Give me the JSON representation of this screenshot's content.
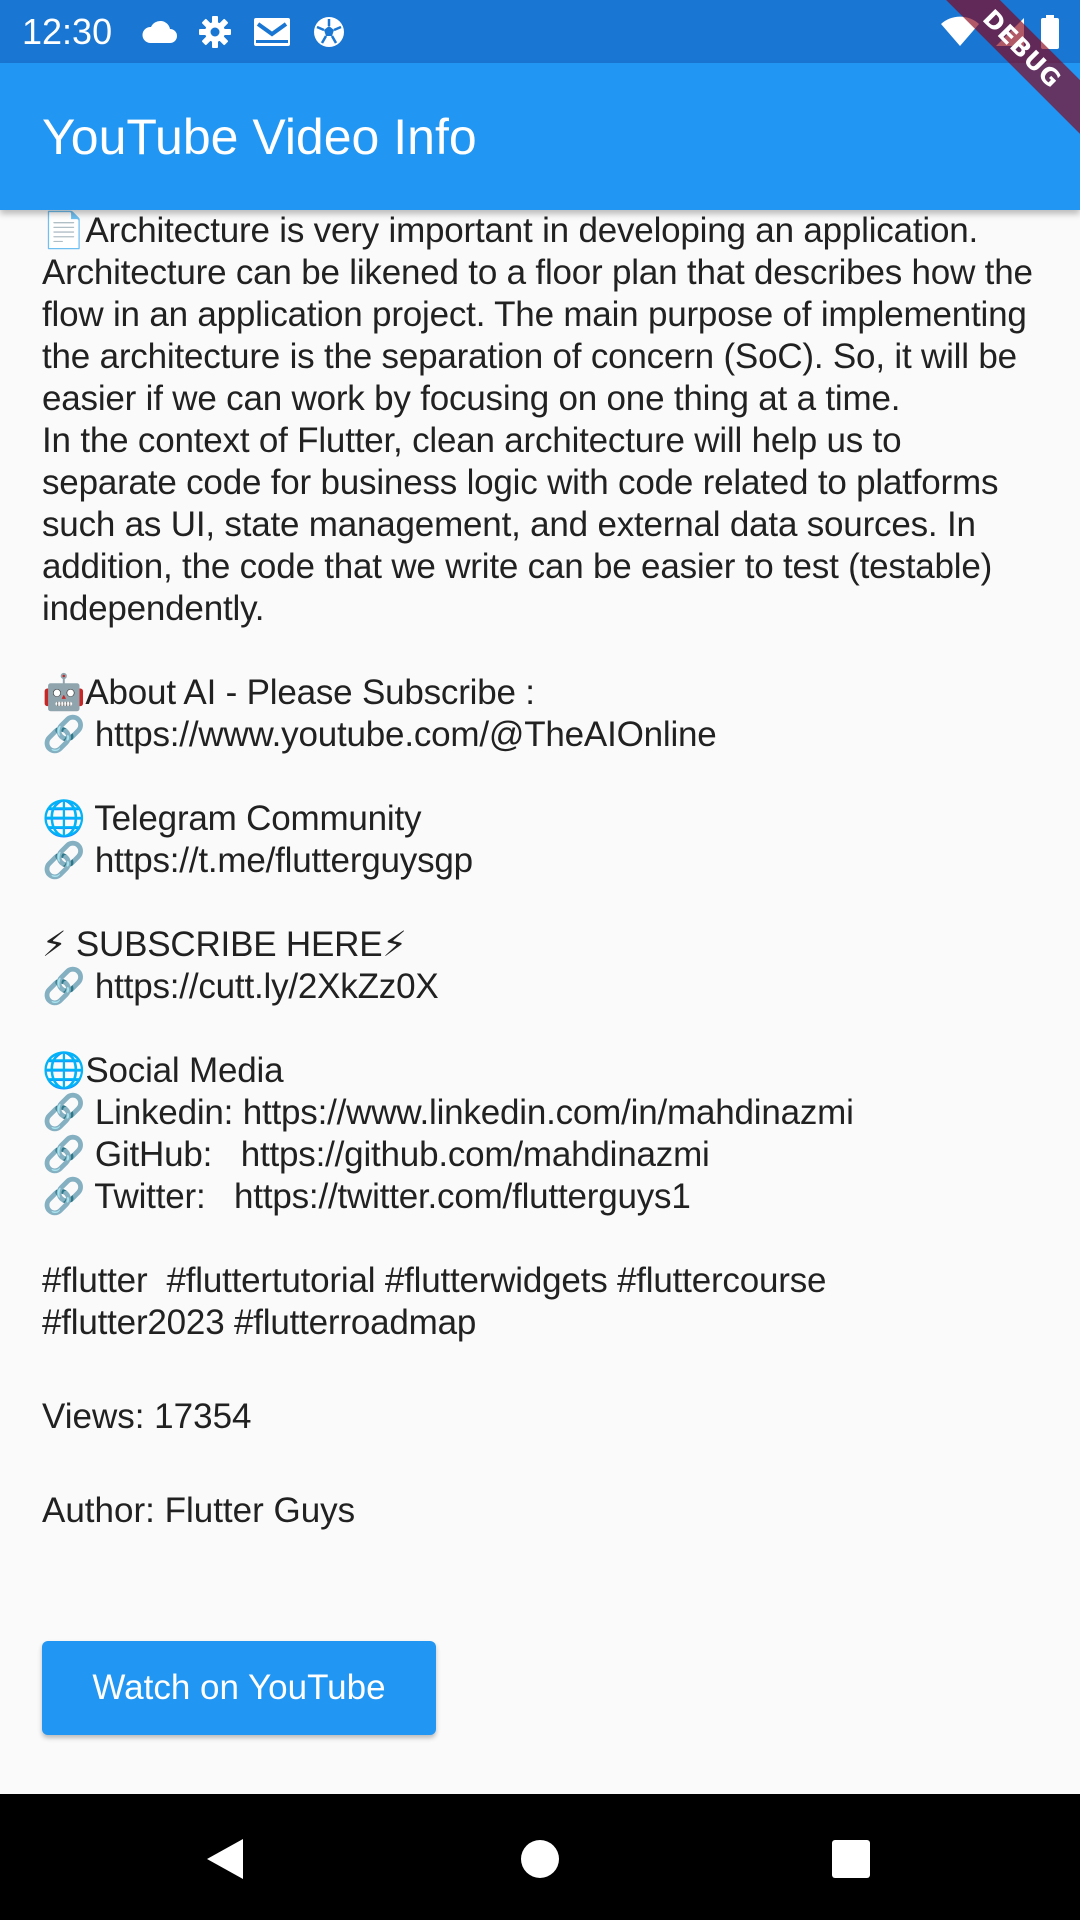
{
  "status_bar": {
    "time": "12:30",
    "left_icons": [
      "cloud-icon",
      "gear-icon",
      "mail-icon",
      "soccer-ball-icon"
    ],
    "right_icons": [
      "wifi-icon",
      "signal-icon",
      "battery-icon"
    ]
  },
  "debug_banner": "DEBUG",
  "app_bar": {
    "title": "YouTube Video Info"
  },
  "video": {
    "description": "📄Architecture is very important in developing an application. Architecture can be likened to a floor plan that describes how the flow in an application project. The main purpose of implementing the architecture is the separation of concern (SoC). So, it will be easier if we can work by focusing on one thing at a time.\nIn the context of Flutter, clean architecture will help us to separate code for business logic with code related to platforms such as UI, state management, and external data sources. In addition, the code that we write can be easier to test (testable) independently.\n\n🤖About AI - Please Subscribe :\n🔗 https://www.youtube.com/@TheAIOnline\n\n🌐 Telegram Community\n🔗 https://t.me/flutterguysgp\n\n⚡ SUBSCRIBE HERE⚡\n🔗 https://cutt.ly/2XkZz0X\n\n🌐Social Media\n🔗 Linkedin: https://www.linkedin.com/in/mahdinazmi\n🔗 GitHub:   https://github.com/mahdinazmi\n🔗 Twitter:   https://twitter.com/flutterguys1\n\n#flutter  #fluttertutorial #flutterwidgets #fluttercourse\n#flutter2023 #flutterroadmap",
    "views": "Views: 17354",
    "author": "Author: Flutter Guys",
    "button_label": "Watch on YouTube"
  },
  "nav_bar": {
    "icons": [
      "back-icon",
      "home-icon",
      "recents-icon"
    ]
  },
  "colors": {
    "status_bar": "#1976d2",
    "app_bar": "#2196f3",
    "button": "#2196f3",
    "text": "#212121",
    "background": "#fafafa"
  }
}
